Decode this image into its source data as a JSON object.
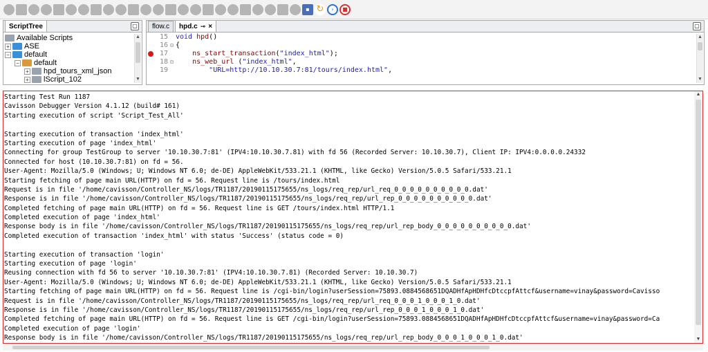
{
  "toolbar": {
    "buttons": [
      {
        "name": "run-icon"
      },
      {
        "name": "debug-icon"
      },
      {
        "name": "step-icon"
      },
      {
        "name": "pause-icon"
      },
      {
        "name": "resume-icon"
      },
      {
        "name": "comment-icon"
      },
      {
        "name": "bookmark-icon"
      },
      {
        "name": "page-icon"
      },
      {
        "name": "copy-icon"
      },
      {
        "name": "download-icon"
      },
      {
        "name": "upload-icon"
      },
      {
        "name": "link-icon"
      },
      {
        "name": "tag-icon"
      },
      {
        "name": "puzzle-icon"
      },
      {
        "name": "gear-icon"
      },
      {
        "name": "network-icon"
      },
      {
        "name": "record-icon"
      },
      {
        "name": "stop-record-icon"
      },
      {
        "name": "grid-icon"
      },
      {
        "name": "edit-icon"
      },
      {
        "name": "monitor-icon"
      },
      {
        "name": "export-icon"
      },
      {
        "name": "import-icon"
      },
      {
        "name": "person-icon"
      },
      {
        "name": "save-icon"
      },
      {
        "name": "refresh-icon"
      },
      {
        "name": "next-icon"
      },
      {
        "name": "stop-icon"
      }
    ]
  },
  "script_tree": {
    "tab_label": "ScriptTree",
    "items": [
      {
        "label": "Available Scripts",
        "level": 0,
        "expander": "",
        "folder": "gray"
      },
      {
        "label": "ASE",
        "level": 0,
        "expander": "+",
        "folder": "blue"
      },
      {
        "label": "default",
        "level": 0,
        "expander": "−",
        "folder": "blue"
      },
      {
        "label": "default",
        "level": 1,
        "expander": "−",
        "folder": "orange"
      },
      {
        "label": "hpd_tours_xml_json",
        "level": 2,
        "expander": "+",
        "folder": "gray"
      },
      {
        "label": "lScript_102",
        "level": 2,
        "expander": "+",
        "folder": "gray"
      }
    ]
  },
  "editor": {
    "tabs": [
      {
        "label": "flow.c",
        "active": false
      },
      {
        "label": "hpd.c",
        "active": true
      }
    ],
    "lines": [
      {
        "num": "15",
        "fold": "",
        "bp": false,
        "parts": [
          [
            "kw",
            "void "
          ],
          [
            "fn",
            "hpd"
          ],
          [
            "plain",
            "()"
          ]
        ]
      },
      {
        "num": "16",
        "fold": "⊟",
        "bp": false,
        "parts": [
          [
            "plain",
            "{"
          ]
        ]
      },
      {
        "num": "17",
        "fold": "",
        "bp": true,
        "parts": [
          [
            "plain",
            "    "
          ],
          [
            "fn",
            "ns_start_transaction"
          ],
          [
            "plain",
            "("
          ],
          [
            "str",
            "\"index_html\""
          ],
          [
            "plain",
            ");"
          ]
        ]
      },
      {
        "num": "18",
        "fold": "⊟",
        "bp": false,
        "parts": [
          [
            "plain",
            "    "
          ],
          [
            "fn",
            "ns_web_url"
          ],
          [
            "plain",
            " ("
          ],
          [
            "str",
            "\"index_html\""
          ],
          [
            "plain",
            ","
          ]
        ]
      },
      {
        "num": "19",
        "fold": "",
        "bp": false,
        "parts": [
          [
            "plain",
            "        "
          ],
          [
            "str",
            "\"URL=http://10.10.30.7:81/tours/index.html\""
          ],
          [
            "plain",
            ","
          ]
        ]
      }
    ]
  },
  "output": {
    "lines": [
      "Starting Test Run 1187",
      "Cavisson Debugger Version 4.1.12 (build# 161)",
      "Starting execution of script 'Script_Test_All'",
      "",
      "Starting execution of transaction 'index_html'",
      "Starting execution of page 'index_html'",
      "Connecting for group TestGroup to server '10.10.30.7:81' (IPV4:10.10.30.7.81) with fd 56 (Recorded Server: 10.10.30.7), Client IP: IPV4:0.0.0.0.24332",
      "Connected for host (10.10.30.7:81) on fd = 56.",
      "User-Agent: Mozilla/5.0 (Windows; U; Windows NT 6.0; de-DE) AppleWebKit/533.21.1 (KHTML, like Gecko) Version/5.0.5 Safari/533.21.1",
      "Starting fetching of page main URL(HTTP) on fd = 56. Request line is /tours/index.html",
      "Request is in file '/home/cavisson/Controller_NS/logs/TR1187/20190115175655/ns_logs/req_rep/url_req_0_0_0_0_0_0_0_0_0_0.dat'",
      "Response is in file '/home/cavisson/Controller_NS/logs/TR1187/20190115175655/ns_logs/req_rep/url_rep_0_0_0_0_0_0_0_0_0_0.dat'",
      "Completed fetching of page main URL(HTTP) on fd = 56. Request line is GET /tours/index.html HTTP/1.1",
      "Completed execution of page 'index_html'",
      "Response body is in file '/home/cavisson/Controller_NS/logs/TR1187/20190115175655/ns_logs/req_rep/url_rep_body_0_0_0_0_0_0_0_0_0_0.dat'",
      "Completed execution of transaction 'index_html' with status 'Success' (status code = 0)",
      "",
      "Starting execution of transaction 'login'",
      "Starting execution of page 'login'",
      "Reusing connection with fd 56 to server '10.10.30.7:81' (IPV4:10.10.30.7.81) (Recorded Server: 10.10.30.7)",
      "User-Agent: Mozilla/5.0 (Windows; U; Windows NT 6.0; de-DE) AppleWebKit/533.21.1 (KHTML, like Gecko) Version/5.0.5 Safari/533.21.1",
      "Starting fetching of page main URL(HTTP) on fd = 56. Request line is /cgi-bin/login?userSession=75893.0884568651DQADHfApHDHfcDtccpfAttcf&username=vinay&password=Cavisso",
      "Request is in file '/home/cavisson/Controller_NS/logs/TR1187/20190115175655/ns_logs/req_rep/url_req_0_0_0_1_0_0_0_1_0.dat'",
      "Response is in file '/home/cavisson/Controller_NS/logs/TR1187/20190115175655/ns_logs/req_rep/url_rep_0_0_0_1_0_0_0_1_0.dat'",
      "Completed fetching of page main URL(HTTP) on fd = 56. Request line is GET /cgi-bin/login?userSession=75893.0884568651DQADHfApHDHfcDtccpfAttcf&username=vinay&password=Ca",
      "Completed execution of page 'login'",
      "Response body is in file '/home/cavisson/Controller_NS/logs/TR1187/20190115175655/ns_logs/req_rep/url_rep_body_0_0_0_1_0_0_0_1_0.dat'"
    ]
  }
}
